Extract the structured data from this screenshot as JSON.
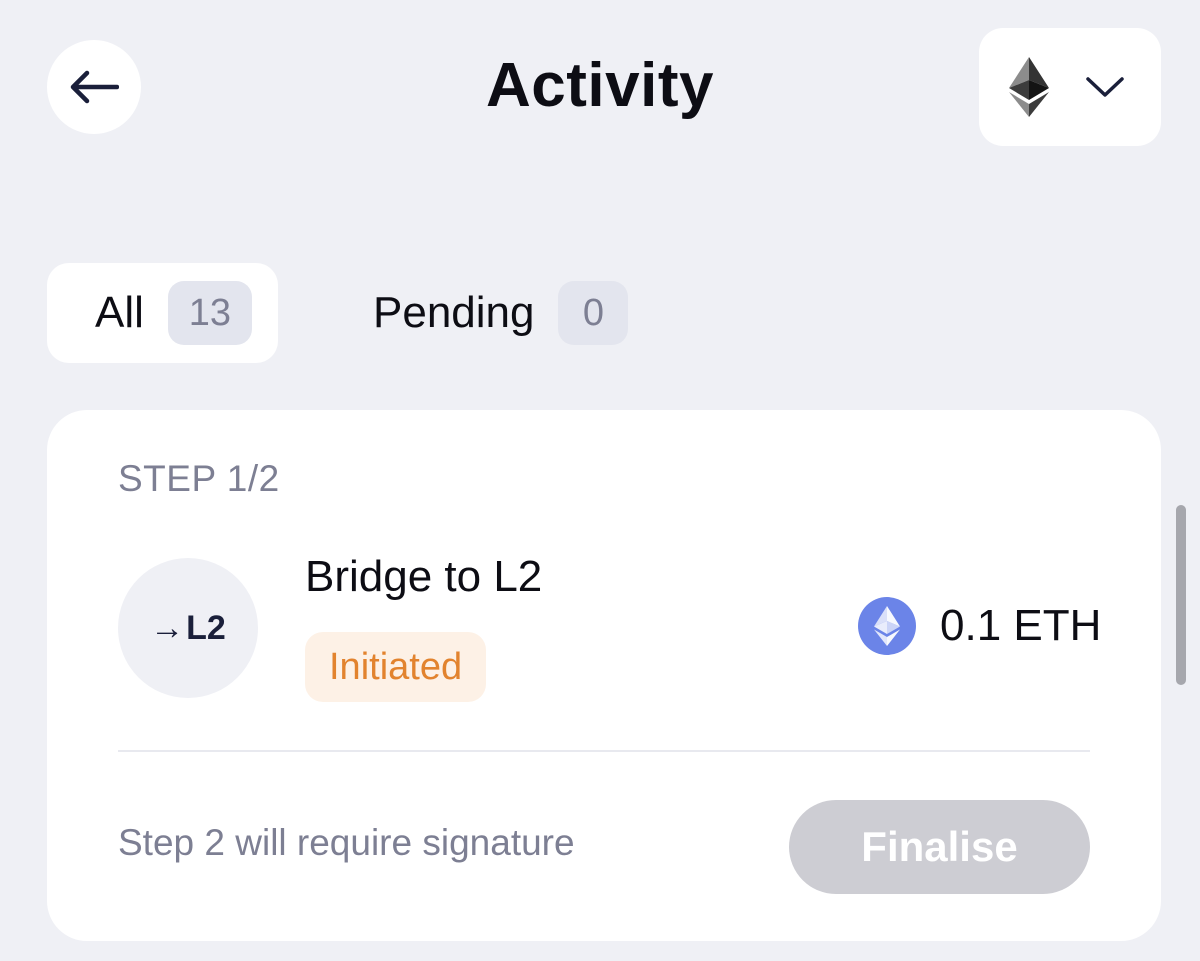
{
  "header": {
    "title": "Activity",
    "back_icon": "arrow-left-icon",
    "network_icon": "ethereum-icon",
    "dropdown_icon": "chevron-down-icon"
  },
  "tabs": [
    {
      "label": "All",
      "count": "13",
      "selected": true
    },
    {
      "label": "Pending",
      "count": "0",
      "selected": false
    }
  ],
  "transaction": {
    "step": "STEP 1/2",
    "icon_text": "L2",
    "icon_arrow": "→",
    "title": "Bridge to L2",
    "status": "Initiated",
    "amount": "0.1 ETH",
    "token_icon": "ethereum-coin-icon",
    "note": "Step 2 will require signature",
    "action_label": "Finalise",
    "action_enabled": false
  },
  "colors": {
    "background": "#eff0f5",
    "status_text": "#e2832e",
    "status_bg": "#fdf1e6",
    "eth_coin": "#6b84e8",
    "disabled_button": "#cdcdd3"
  }
}
